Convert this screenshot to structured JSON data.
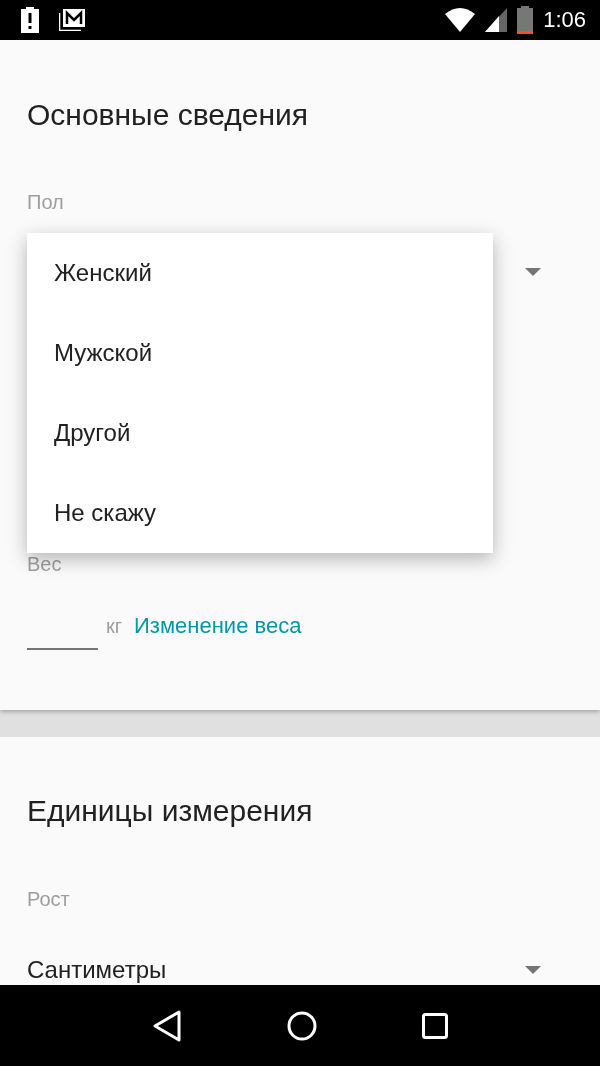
{
  "status_bar": {
    "time": "1:06"
  },
  "basic_info": {
    "title": "Основные сведения",
    "gender_label": "Пол",
    "weight_label": "Вес",
    "weight_unit": "кг",
    "weight_link": "Изменение веса"
  },
  "gender_menu": {
    "options": [
      {
        "label": "Женский"
      },
      {
        "label": "Мужской"
      },
      {
        "label": "Другой"
      },
      {
        "label": "Не скажу"
      }
    ]
  },
  "units": {
    "title": "Единицы измерения",
    "height_label": "Рост",
    "height_value": "Сантиметры"
  }
}
